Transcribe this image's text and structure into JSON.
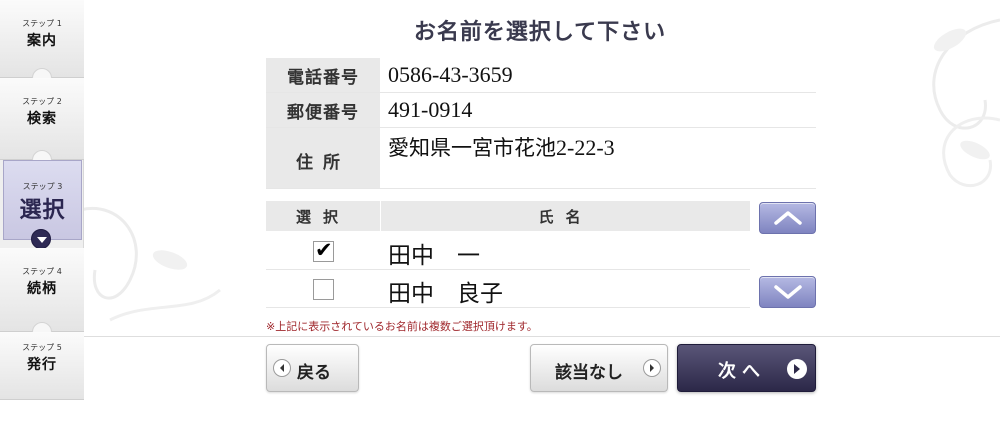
{
  "title": "お名前を選択して下さい",
  "steps": [
    {
      "num": "ステップ 1",
      "label": "案内"
    },
    {
      "num": "ステップ 2",
      "label": "検索"
    },
    {
      "num": "ステップ 3",
      "label": "選択"
    },
    {
      "num": "ステップ 4",
      "label": "続柄"
    },
    {
      "num": "ステップ 5",
      "label": "発行"
    }
  ],
  "active_step": 3,
  "info": {
    "phone_label": "電話番号",
    "phone_value": "0586-43-3659",
    "zip_label": "郵便番号",
    "zip_value": "491-0914",
    "address_label": "住所",
    "address_value_text": "愛知県一宮市花池",
    "address_value_num": "2-22-3"
  },
  "list": {
    "header_select": "選択",
    "header_name": "氏名",
    "rows": [
      {
        "checked": true,
        "name": "田中　一"
      },
      {
        "checked": false,
        "name": "田中　良子"
      }
    ]
  },
  "note": "※上記に表示されているお名前は複数ご選択頂けます。",
  "buttons": {
    "back": "戻る",
    "none": "該当なし",
    "next": "次へ"
  },
  "colors": {
    "accent_dark": "#2c2848",
    "scroll_button": "#8f94cc",
    "note": "#a0282d"
  },
  "icons": {
    "scroll_up": "chevron-up-icon",
    "scroll_down": "chevron-down-icon",
    "back": "arrow-left-circle-icon",
    "next": "arrow-right-circle-icon"
  }
}
